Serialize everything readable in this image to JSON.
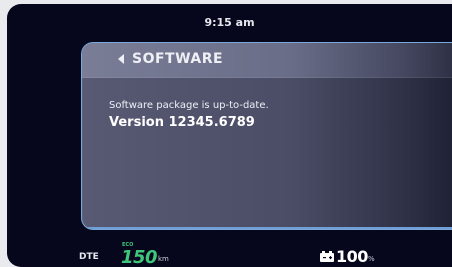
{
  "status_bar": {
    "time": "9:15 am"
  },
  "panel": {
    "back_label": "SOFTWARE",
    "status_message": "Software package is up-to-date.",
    "version": "Version 12345.6789"
  },
  "footer": {
    "dte_label": "DTE",
    "eco_label": "ECO",
    "range_value": "150",
    "range_unit": "km",
    "battery_value": "100",
    "battery_unit": "%",
    "battery_level_percent": 100
  },
  "colors": {
    "eco_green": "#3ec77a",
    "panel_border": "#7aa8d8",
    "background": "#06061d"
  },
  "icons": {
    "back": "chevron-left-icon",
    "battery": "battery-icon"
  }
}
